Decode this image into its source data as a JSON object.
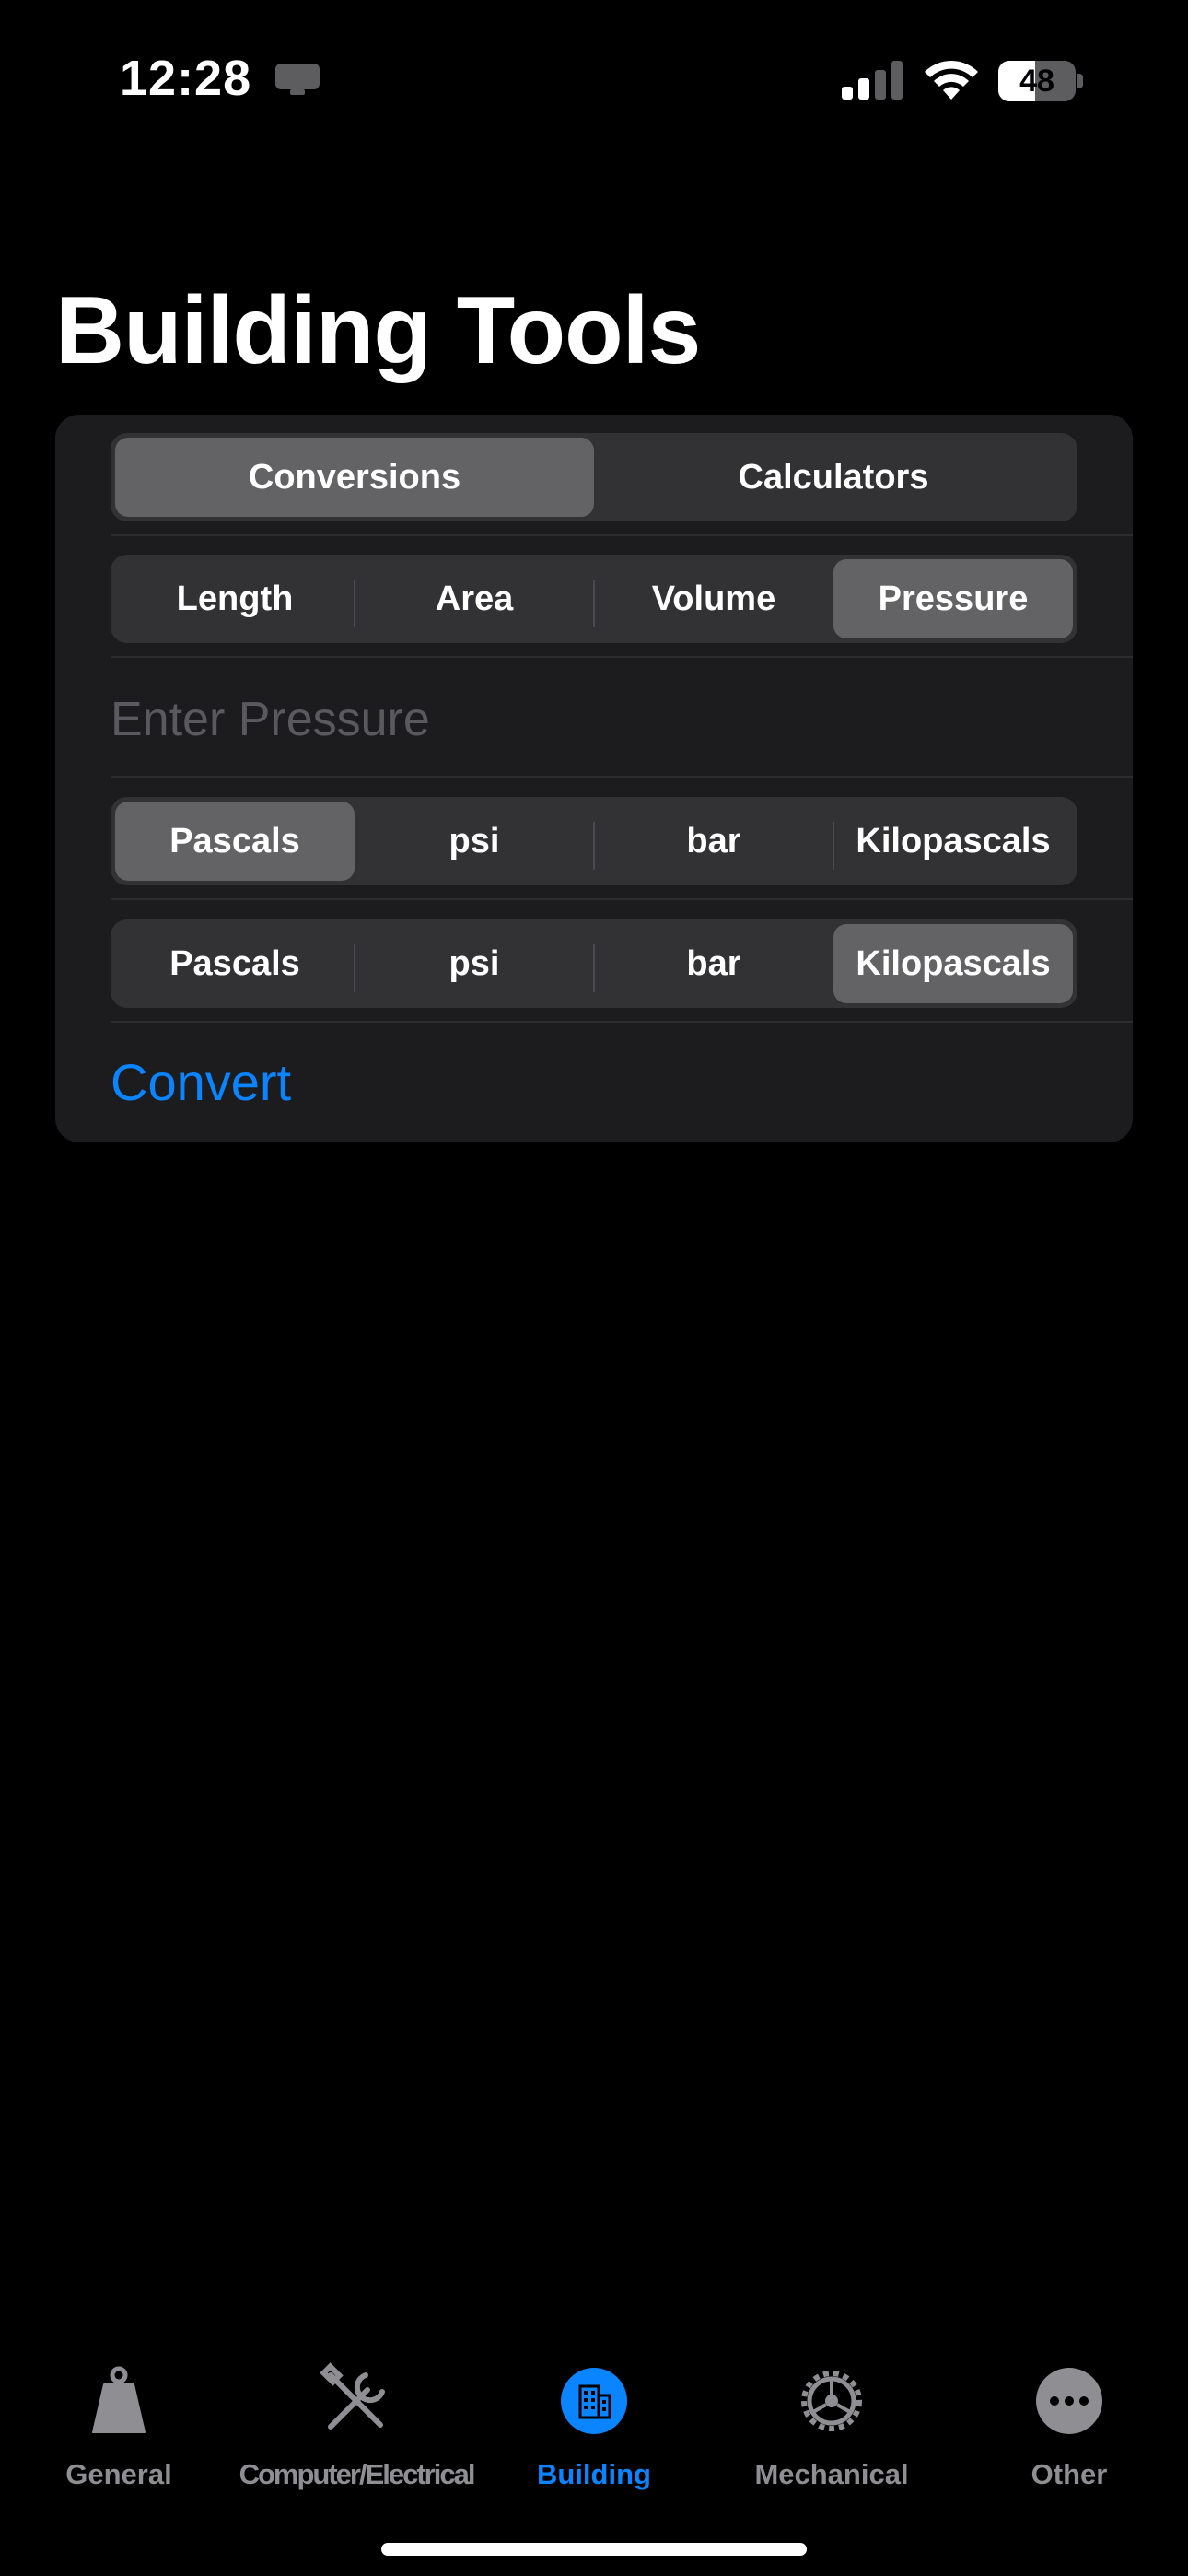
{
  "status_bar": {
    "time": "12:28",
    "battery_level": "48",
    "battery_fraction": 0.48
  },
  "page": {
    "title": "Building Tools"
  },
  "mode_segment": {
    "options": [
      "Conversions",
      "Calculators"
    ],
    "selected": "Conversions"
  },
  "category_segment": {
    "options": [
      "Length",
      "Area",
      "Volume",
      "Pressure"
    ],
    "selected": "Pressure"
  },
  "input": {
    "placeholder": "Enter Pressure",
    "value": ""
  },
  "from_unit_segment": {
    "options": [
      "Pascals",
      "psi",
      "bar",
      "Kilopascals"
    ],
    "selected": "Pascals"
  },
  "to_unit_segment": {
    "options": [
      "Pascals",
      "psi",
      "bar",
      "Kilopascals"
    ],
    "selected": "Kilopascals"
  },
  "convert_label": "Convert",
  "tab_bar": {
    "tabs": [
      {
        "label": "General",
        "icon": "weight-icon"
      },
      {
        "label": "Computer/Electrical",
        "icon": "wrench-screwdriver-icon"
      },
      {
        "label": "Building",
        "icon": "building-icon"
      },
      {
        "label": "Mechanical",
        "icon": "gear-icon"
      },
      {
        "label": "Other",
        "icon": "ellipsis-icon"
      }
    ],
    "active": "Building"
  },
  "colors": {
    "accent": "#0a84ff",
    "background": "#000000",
    "card": "#1c1c1e",
    "segment_bg": "#323235",
    "segment_selected": "#636366",
    "inactive_tab": "#8e8e93"
  }
}
